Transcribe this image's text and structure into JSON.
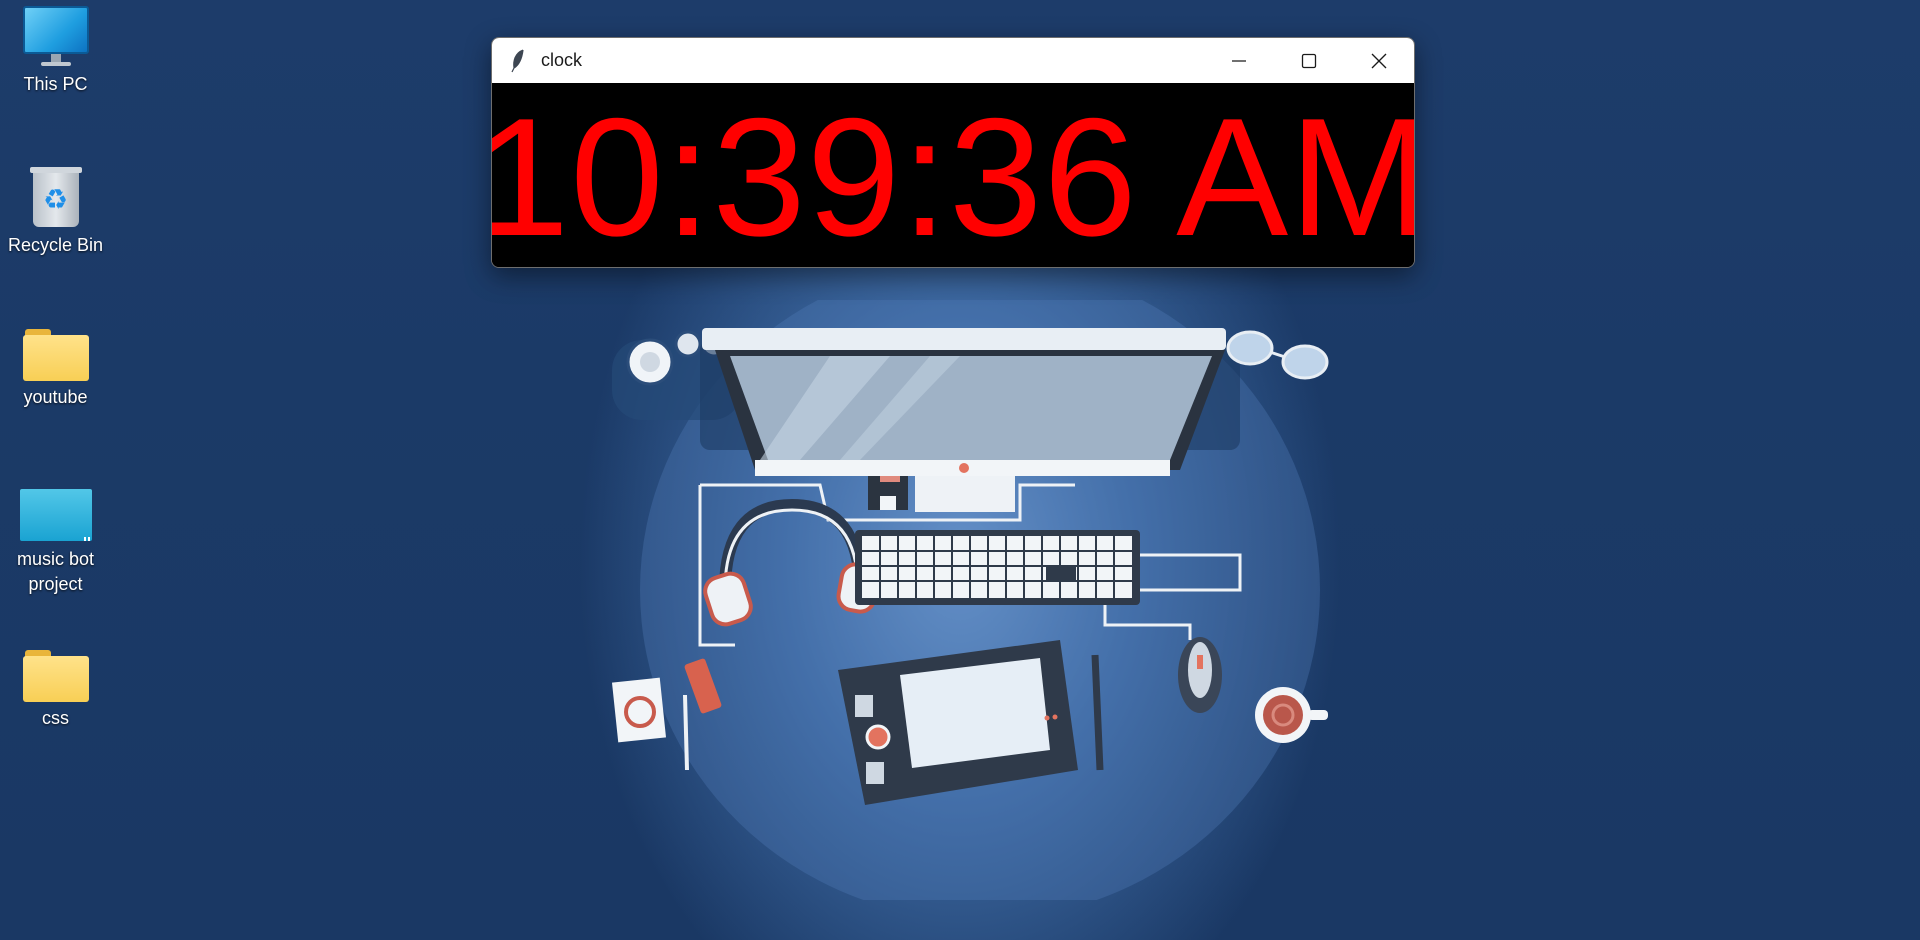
{
  "desktop": {
    "icons": [
      {
        "label": "This PC",
        "icon": "monitor-icon"
      },
      {
        "label": "Recycle Bin",
        "icon": "recycle-bin-icon"
      },
      {
        "label": "youtube",
        "icon": "folder-icon"
      },
      {
        "label": "music bot project",
        "icon": "project-icon"
      },
      {
        "label": "css",
        "icon": "folder-icon"
      }
    ]
  },
  "window": {
    "title": "clock",
    "icon": "feather-icon",
    "time": "10:39:36 AM",
    "time_color": "#ff0000",
    "background_color": "#000000",
    "controls": {
      "minimize": "minimize-icon",
      "maximize": "maximize-icon",
      "close": "close-icon"
    }
  },
  "wallpaper": {
    "description_icon": "desk-setup-illustration"
  }
}
